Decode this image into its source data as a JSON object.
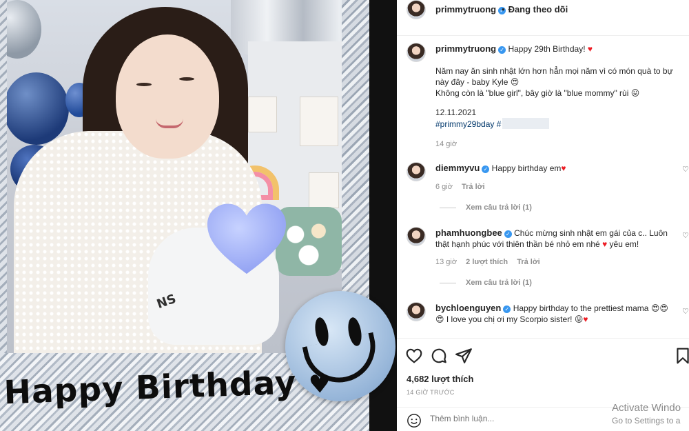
{
  "post": {
    "username": "primmytruong",
    "follow_status": "Đang theo dõi",
    "photo_text": "Happy Birthday"
  },
  "caption": {
    "username": "primmytruong",
    "text": "Happy 29th Birthday!",
    "line1": "Năm nay ăn sinh nhật lớn hơn hẳn mọi năm vì có món quà to bự này đây - baby Kyle",
    "line2": "Không còn là \"blue girl\", bây giờ là \"blue mommy\" rùi",
    "date": "12.11.2021",
    "hashtag1": "#primmy29bday",
    "hashtag2": "#",
    "time": "14 giờ"
  },
  "comments": [
    {
      "username": "diemmyvu",
      "text": "Happy birthday em",
      "time": "6 giờ",
      "reply_label": "Trả lời",
      "view_replies": "Xem câu trả lời (1)"
    },
    {
      "username": "phamhuongbee",
      "text_a": "Chúc mừng sinh nhật em gái của c.. Luôn thật hạnh phúc với thiên thần bé nhỏ em nhé",
      "text_b": "yêu em!",
      "time": "13 giờ",
      "likes": "2 lượt thích",
      "reply_label": "Trả lời",
      "view_replies": "Xem câu trả lời (1)"
    },
    {
      "username": "bychloenguyen",
      "text_a": "Happy birthday to the prettiest mama",
      "text_b": "I love you chị ơi my Scorpio sister!"
    }
  ],
  "actions": {
    "likes_count": "4,682 lượt thích",
    "time_ago": "14 GIỜ TRƯỚC",
    "comment_placeholder": "Thêm bình luận..."
  },
  "overlay": {
    "activate_title": "Activate Windo",
    "activate_sub": "Go to Settings to a"
  },
  "icons": {
    "heart": "heart-icon",
    "comment": "comment-icon",
    "share": "paper-plane-icon",
    "save": "bookmark-icon",
    "emoji": "smile-icon",
    "verified": "verified-badge-icon"
  },
  "colors": {
    "link": "#00376b",
    "verified": "#3897f0",
    "heart": "#ed1c24",
    "muted": "#8e8e8e"
  }
}
